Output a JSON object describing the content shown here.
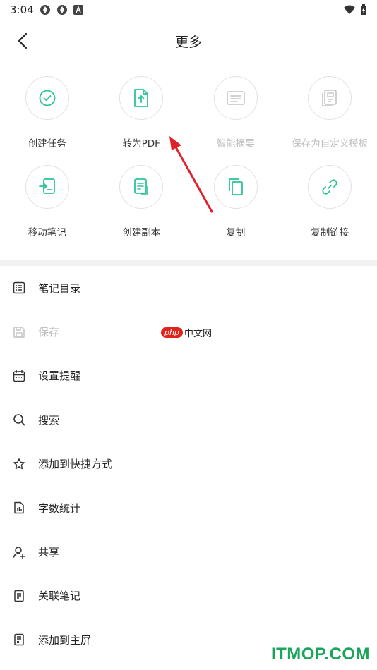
{
  "status_bar": {
    "time": "3:04"
  },
  "header": {
    "title": "更多"
  },
  "grid": [
    {
      "label": "创建任务",
      "icon": "check-circle-icon",
      "enabled": true
    },
    {
      "label": "转为PDF",
      "icon": "file-export-icon",
      "enabled": true
    },
    {
      "label": "智能摘要",
      "icon": "summary-icon",
      "enabled": false
    },
    {
      "label": "保存为自定义模板",
      "icon": "template-icon",
      "enabled": false
    },
    {
      "label": "移动笔记",
      "icon": "move-note-icon",
      "enabled": true
    },
    {
      "label": "创建副本",
      "icon": "duplicate-icon",
      "enabled": true
    },
    {
      "label": "复制",
      "icon": "copy-icon",
      "enabled": true
    },
    {
      "label": "复制链接",
      "icon": "link-icon",
      "enabled": true
    }
  ],
  "menu": [
    {
      "label": "笔记目录",
      "icon": "list-icon",
      "enabled": true
    },
    {
      "label": "保存",
      "icon": "save-icon",
      "enabled": false
    },
    {
      "label": "设置提醒",
      "icon": "calendar-icon",
      "enabled": true
    },
    {
      "label": "搜索",
      "icon": "search-icon",
      "enabled": true
    },
    {
      "label": "添加到快捷方式",
      "icon": "star-icon",
      "enabled": true
    },
    {
      "label": "字数统计",
      "icon": "word-count-icon",
      "enabled": true
    },
    {
      "label": "共享",
      "icon": "share-user-icon",
      "enabled": true
    },
    {
      "label": "关联笔记",
      "icon": "related-note-icon",
      "enabled": true
    },
    {
      "label": "添加到主屏",
      "icon": "home-screen-icon",
      "enabled": true
    }
  ],
  "watermarks": {
    "php_badge": "php",
    "php_text": "中文网",
    "site": "ITMOP.COM"
  },
  "colors": {
    "accent": "#2bc39a",
    "disabled": "#c4c4c4",
    "arrow": "#e0202a"
  }
}
